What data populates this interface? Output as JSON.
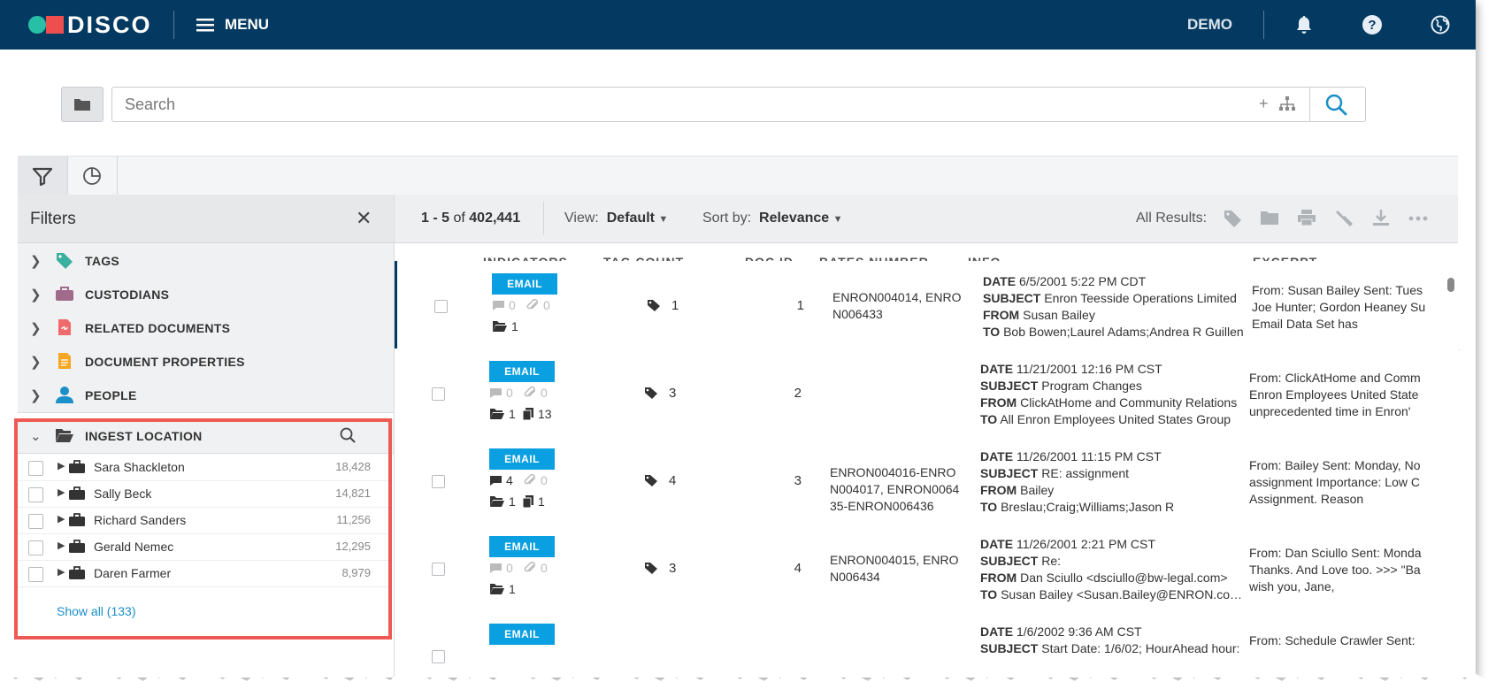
{
  "header": {
    "logo_text": "DISCO",
    "menu_label": "MENU",
    "account_label": "DEMO",
    "icons": [
      "hamburger-icon",
      "bell-icon",
      "help-icon",
      "user-globe-icon"
    ]
  },
  "search": {
    "placeholder": "Search",
    "add_label": "+",
    "icons": [
      "folder-icon",
      "tree-icon",
      "search-icon"
    ]
  },
  "tabs": [
    {
      "name": "filter",
      "icon": "funnel-icon",
      "active": true
    },
    {
      "name": "analytics",
      "icon": "pie-chart-icon",
      "active": false
    }
  ],
  "filters": {
    "title": "Filters",
    "close_label": "✕",
    "sections": [
      {
        "label": "TAGS",
        "icon": "tag-icon",
        "color": "#3ab09e"
      },
      {
        "label": "CUSTODIANS",
        "icon": "briefcase-icon",
        "color": "#a06a8a"
      },
      {
        "label": "RELATED DOCUMENTS",
        "icon": "link-doc-icon",
        "color": "#ef6a6a"
      },
      {
        "label": "DOCUMENT PROPERTIES",
        "icon": "document-icon",
        "color": "#f5a623"
      },
      {
        "label": "PEOPLE",
        "icon": "person-icon",
        "color": "#1a8fc8"
      },
      {
        "label": "INGEST LOCATION",
        "icon": "open-folder-icon",
        "color": "#444444"
      }
    ],
    "ingest_items": [
      {
        "name": "Sara Shackleton",
        "count": "18,428"
      },
      {
        "name": "Sally Beck",
        "count": "14,821"
      },
      {
        "name": "Richard Sanders",
        "count": "11,256"
      },
      {
        "name": "Gerald Nemec",
        "count": "12,295"
      },
      {
        "name": "Daren Farmer",
        "count": "8,979"
      }
    ],
    "show_all": "Show all (133)"
  },
  "results": {
    "range": "1 - 5",
    "of_label": "of",
    "total": "402,441",
    "view_label": "View:",
    "view_value": "Default",
    "sort_label": "Sort by:",
    "sort_value": "Relevance",
    "all_results_label": "All Results:",
    "action_icons": [
      "tag-icon",
      "folder-icon",
      "print-icon",
      "hammer-icon",
      "download-icon",
      "more-icon"
    ],
    "columns": [
      "INDICATORS",
      "TAG COUNT",
      "DOC ID",
      "BATES NUMBER",
      "INFO",
      "EXCERPT"
    ],
    "rows": [
      {
        "badge": "EMAIL",
        "comments": "0",
        "attachments": "0",
        "folders": "1",
        "docs": "",
        "tag_count": "1",
        "doc_id": "1",
        "bates": "ENRON004014, ENRON006433",
        "date": "6/5/2001 5:22 PM CDT",
        "subject": "Enron Teesside Operations Limited",
        "from": "Susan Bailey",
        "to": "Bob Bowen;Laurel Adams;Andrea R Guillen",
        "excerpt": [
          "From: Susan Bailey Sent: Tues",
          "Joe Hunter; Gordon Heaney Su",
          "Email Data Set has"
        ]
      },
      {
        "badge": "EMAIL",
        "comments": "0",
        "attachments": "0",
        "folders": "1",
        "docs": "13",
        "tag_count": "3",
        "doc_id": "2",
        "bates": "",
        "date": "11/21/2001 12:16 PM CST",
        "subject": "Program Changes",
        "from": "ClickAtHome and Community Relations",
        "to": "All Enron Employees United States Group",
        "excerpt": [
          "From: ClickAtHome and Comm",
          "Enron Employees United State",
          "unprecedented time in Enron'"
        ]
      },
      {
        "badge": "EMAIL",
        "comments": "4",
        "attachments": "0",
        "folders": "1",
        "docs": "1",
        "tag_count": "4",
        "doc_id": "3",
        "bates": "ENRON004016-ENRON004017, ENRON006435-ENRON006436",
        "date": "11/26/2001 11:15 PM CST",
        "subject": "RE: assignment",
        "from": "Bailey",
        "to": "Breslau;Craig;Williams;Jason R",
        "excerpt": [
          "From: Bailey Sent: Monday, No",
          "assignment Importance: Low C",
          "Assignment. Reason"
        ]
      },
      {
        "badge": "EMAIL",
        "comments": "0",
        "attachments": "0",
        "folders": "1",
        "docs": "",
        "tag_count": "3",
        "doc_id": "4",
        "bates": "ENRON004015, ENRON006434",
        "date": "11/26/2001 2:21 PM CST",
        "subject": "Re:",
        "from": "Dan Sciullo <dsciullo@bw-legal.com>",
        "to": "Susan Bailey <Susan.Bailey@ENRON.com>",
        "excerpt": [
          "From: Dan Sciullo Sent: Monda",
          "Thanks. And Love too. >>> \"Ba",
          "wish you, Jane,"
        ]
      },
      {
        "badge": "EMAIL",
        "comments": "",
        "attachments": "",
        "folders": "",
        "docs": "",
        "tag_count": "",
        "doc_id": "",
        "bates": "",
        "date": "1/6/2002 9:36 AM CST",
        "subject": "Start Date: 1/6/02; HourAhead hour:",
        "from": "",
        "to": "",
        "excerpt": [
          "From: Schedule Crawler Sent:",
          "",
          ""
        ]
      }
    ],
    "info_labels": {
      "date": "DATE",
      "subject": "SUBJECT",
      "from": "FROM",
      "to": "TO"
    }
  },
  "colors": {
    "topbar": "#043a61",
    "accent": "#0a9fe0",
    "highlight": "#ee5a53",
    "logo_green": "#27c0a6",
    "logo_red": "#ef4e4e"
  }
}
